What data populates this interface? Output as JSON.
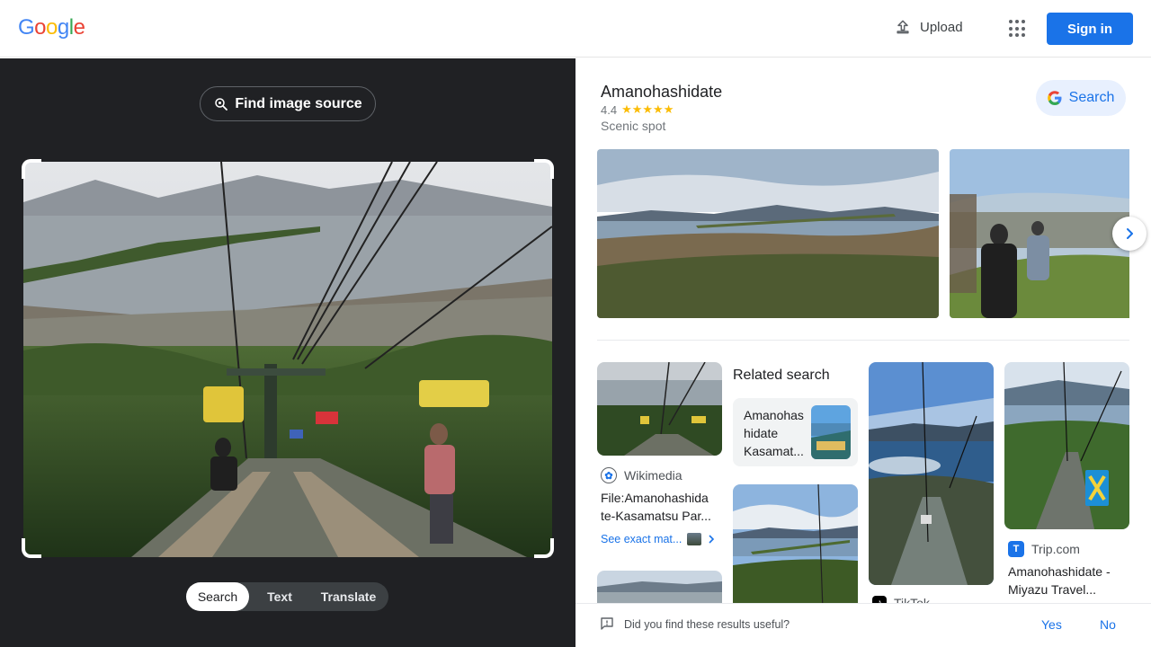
{
  "header": {
    "logo_letters": [
      {
        "ch": "G",
        "color": "#4285f4"
      },
      {
        "ch": "o",
        "color": "#ea4335"
      },
      {
        "ch": "o",
        "color": "#fbbc05"
      },
      {
        "ch": "g",
        "color": "#4285f4"
      },
      {
        "ch": "l",
        "color": "#34a853"
      },
      {
        "ch": "e",
        "color": "#ea4335"
      }
    ],
    "upload_label": "Upload",
    "apps_icon": "apps-grid-icon",
    "signin_label": "Sign in"
  },
  "left": {
    "find_source_label": "Find image source",
    "modes": [
      "Search",
      "Text",
      "Translate"
    ],
    "active_mode": "Search"
  },
  "knowledge_panel": {
    "title": "Amanohashidate",
    "rating": "4.4",
    "stars": "★★★★★",
    "type": "Scenic spot",
    "search_button": "Search"
  },
  "results": {
    "wikimedia": {
      "source": "Wikimedia",
      "title": "File:Amanohashida te-Kasamatsu Par...",
      "exact_matches": "See exact mat..."
    },
    "related": {
      "heading": "Related search",
      "card_text": "Amanohas hidate Kasamat..."
    },
    "trip": {
      "source": "Trip.com",
      "title": "Amanohashidate - Miyazu Travel..."
    },
    "tiktok": {
      "source": "TikTok"
    }
  },
  "feedback": {
    "question": "Did you find these results useful?",
    "yes": "Yes",
    "no": "No"
  },
  "colors": {
    "accent": "#1a73e8",
    "dark_pane": "#202124",
    "star": "#fbbc04"
  }
}
